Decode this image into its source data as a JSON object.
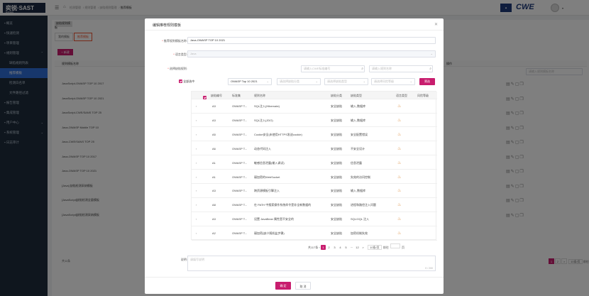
{
  "app": {
    "logo": "奕锐·SAST",
    "logo_sub": "RONGU"
  },
  "breadcrumb": [
    "检测管理",
    "规则管理",
    "缺陷规则管理",
    "推荐模板"
  ],
  "sidebar": {
    "items": [
      {
        "label": "概览",
        "icon": "home-icon"
      },
      {
        "label": "快速检测",
        "icon": "lightning-icon"
      },
      {
        "label": "项目管理",
        "icon": "folder-icon"
      },
      {
        "label": "规则管理",
        "icon": "rule-icon",
        "caret": "⌃"
      },
      {
        "label": "缺陷规则列表",
        "sub": true
      },
      {
        "label": "推荐模板",
        "sub": true,
        "active": true
      },
      {
        "label": "检测白名单",
        "sub": true
      },
      {
        "label": "文件路径过滤",
        "sub": true
      },
      {
        "label": "报告管理",
        "icon": "report-icon"
      },
      {
        "label": "集成管理",
        "icon": "integration-icon"
      },
      {
        "label": "用户中心",
        "icon": "user-icon",
        "caret": "⌄"
      },
      {
        "label": "系统管理",
        "icon": "settings-icon",
        "caret": "⌄"
      },
      {
        "label": "日志审计",
        "icon": "log-icon"
      }
    ]
  },
  "background": {
    "tab_top": "缺陷规则模板",
    "tabs": [
      "我的模板",
      "推荐模板"
    ],
    "add_label": "+ 新建",
    "col_name": "规则模板名称",
    "col_op": "操作",
    "rows": [
      "JavaScript-OWASP TOP 10 2017",
      "JavaScript-OWASP TOP 10 2021",
      "JavaScript-CWE/SANS TOP 25",
      "Java-OWASP Mobile TOP 10",
      "Java-CWE/SANS TOP 25",
      "Java-OWASP TOP 10 2017",
      "Java-OWASP TOP 10 2021",
      "[Java] 缺陷检测采纳模板",
      "[JavaScript]缺陷检测全量模板",
      "[JavaScript]缺陷检测采纳模板"
    ],
    "total": "共11条",
    "pager": [
      "1",
      "2",
      ">"
    ],
    "per_page": "10条/页",
    "jump": "前往",
    "search_ph": "请输入规则模板名称"
  },
  "modal": {
    "title": "编辑推荐规则模板",
    "name_label": "推荐规则模板名称:",
    "name_value": "Java-OWASP TOP 10 2021",
    "lang_label": "语言类型:",
    "lang_value": "Java",
    "rules_label": "选择缺陷规则:",
    "select_all": "全部选中",
    "filter_standard": "OWASP Top 10 2021",
    "filter_class_ph": "请选择缺陷分类",
    "filter_type_ph": "请选择缺陷类型",
    "filter_risk_ph": "请选择风险等级",
    "search_cwe_ph": "请输入CWE标准编号",
    "search_name_ph": "请输入规则名称",
    "filter_btn": "筛选",
    "columns": [
      "缺陷编号",
      "标准集",
      "规则名称",
      "缺陷分类",
      "缺陷类型",
      "语言类型",
      "风险等级"
    ],
    "rows": [
      {
        "id": "A3",
        "std": "OWASP T...",
        "name": "SQL注入(Hibernate)",
        "cls": "安全缺陷",
        "type": "输入,数据库",
        "risk": "高危",
        "level": "high"
      },
      {
        "id": "A3",
        "std": "OWASP T...",
        "name": "SQL注入(JDO)",
        "cls": "安全缺陷",
        "type": "输入,数据库",
        "risk": "高危",
        "level": "high"
      },
      {
        "id": "A5",
        "std": "OWASP T...",
        "name": "Cookie安全(未使用HTTPS发送cookie)",
        "cls": "安全缺陷",
        "type": "安全配置错误",
        "risk": "低危",
        "level": "low"
      },
      {
        "id": "A6",
        "std": "OWASP T...",
        "name": "动态代码注入",
        "cls": "安全缺陷",
        "type": "不安全设计",
        "risk": "低危",
        "level": "low"
      },
      {
        "id": "A1",
        "std": "OWASP T...",
        "name": "敏感信息泄露(输入调试)",
        "cls": "安全缺陷",
        "type": "信息泄露",
        "risk": "低危",
        "level": "low"
      },
      {
        "id": "A1",
        "std": "OWASP T...",
        "name": "弱加密的WebSocket",
        "cls": "安全缺陷",
        "type": "失效的访问控制",
        "risk": "低危",
        "level": "low"
      },
      {
        "id": "A3",
        "std": "OWASP T...",
        "name": "跨资源模板引擎注入",
        "cls": "安全缺陷",
        "type": "输入,数据库",
        "risk": "低危",
        "level": "low"
      },
      {
        "id": "A8",
        "std": "OWASP T...",
        "name": "在 PATH 中搜索操作系统命令是非全新数据的",
        "cls": "安全缺陷",
        "type": "进程和路径注入问题",
        "risk": "低危",
        "level": "low"
      },
      {
        "id": "A3",
        "std": "OWASP T...",
        "name": "设置 JavaBean 属性是不安全的",
        "cls": "安全缺陷",
        "type": "SQL/XQL 注入",
        "risk": "中危",
        "level": "mid"
      },
      {
        "id": "A2",
        "std": "OWASP T...",
        "name": "弱加密(缺少随机盐步骤)",
        "cls": "安全缺陷",
        "type": "加密机制失效",
        "risk": "低危",
        "level": "low"
      }
    ],
    "pager_total": "共117条",
    "pages": [
      "1",
      "2",
      "3",
      "4",
      "5",
      "···",
      "12",
      ">"
    ],
    "per_page": "10条/页",
    "jump": "前往",
    "page_unit": "页",
    "desc_label": "说明:",
    "desc_ph": "请填写说明",
    "count": "0 / 200",
    "ok": "确 定",
    "cancel": "取 消"
  },
  "colors": {
    "accent": "#c81d6e",
    "sidebar": "#1f2d3d",
    "active": "#2f6fd8"
  }
}
